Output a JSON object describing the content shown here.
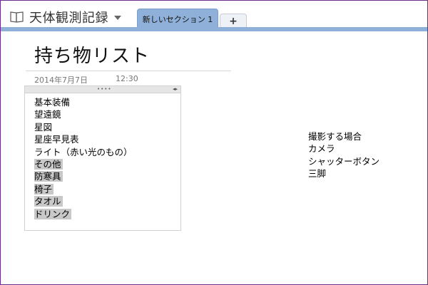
{
  "notebook": {
    "title": "天体観測記録",
    "icon": "notebook-icon"
  },
  "tabs": [
    {
      "label": "新しいセクション 1",
      "active": true
    },
    {
      "label": "+",
      "active": false
    }
  ],
  "page": {
    "title": "持ち物リスト",
    "date": "2014年7月7日",
    "time": "12:30"
  },
  "outline": {
    "items": [
      {
        "text": "基本装備",
        "selected": false
      },
      {
        "text": "望遠鏡",
        "selected": false
      },
      {
        "text": "星図",
        "selected": false
      },
      {
        "text": "星座早見表",
        "selected": false
      },
      {
        "text": "ライト（赤い光のもの）",
        "selected": false
      },
      {
        "text": "その他",
        "selected": true
      },
      {
        "text": "防寒具",
        "selected": true
      },
      {
        "text": "椅子",
        "selected": true
      },
      {
        "text": "タオル",
        "selected": true
      },
      {
        "text": "ドリンク",
        "selected": true
      }
    ]
  },
  "note": {
    "lines": [
      "撮影する場合",
      "カメラ",
      "シャッターボタン",
      "三脚"
    ]
  },
  "colors": {
    "tab_active": "#8fb0d8",
    "selection": "#c8c8c8",
    "window_border": "#6a2d8a"
  }
}
